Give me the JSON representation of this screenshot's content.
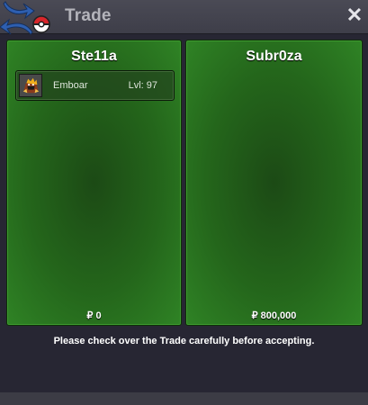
{
  "window": {
    "title": "Trade",
    "logo_icon": "pokeball-arrows-logo-icon",
    "close_icon": "close-icon",
    "close_symbol": "✕"
  },
  "left_panel": {
    "player_name": "Ste11a",
    "items": [
      {
        "name": "Emboar",
        "level": "Lvl: 97",
        "icon": "emboar-sprite-icon"
      }
    ],
    "money": "₽ 0"
  },
  "right_panel": {
    "player_name": "Subr0za",
    "items": [],
    "money": "₽ 800,000"
  },
  "notice": "Please check over the Trade carefully before accepting.",
  "colors": {
    "panel_green": "#24661b",
    "panel_border": "#3d9a2f",
    "window_bg": "#272633",
    "titlebar": "#45454f"
  }
}
